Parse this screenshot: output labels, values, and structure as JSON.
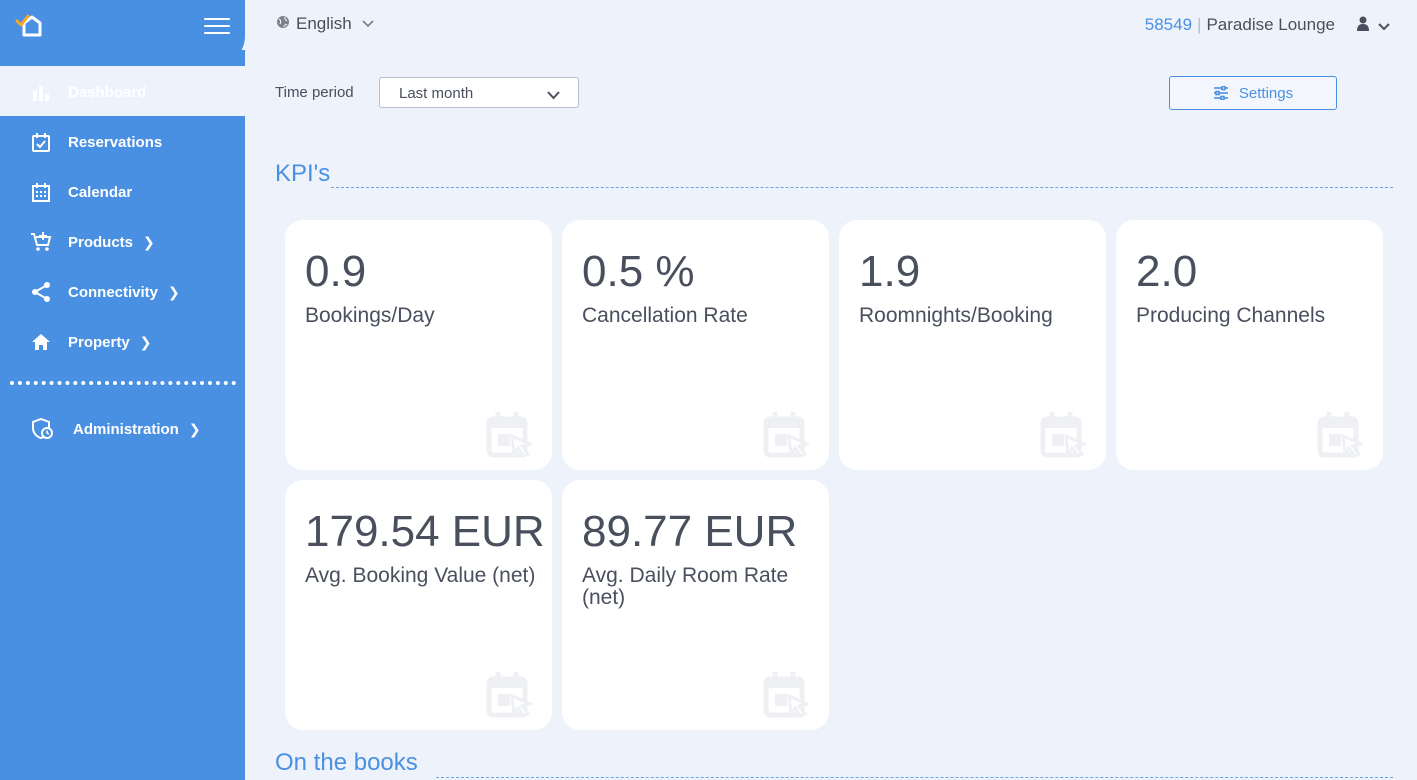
{
  "sidebar": {
    "items": [
      {
        "label": "Dashboard",
        "icon": "bar-chart-icon",
        "active": true
      },
      {
        "label": "Reservations",
        "icon": "calendar-check-icon"
      },
      {
        "label": "Calendar",
        "icon": "calendar-grid-icon"
      },
      {
        "label": "Products",
        "icon": "cart-plus-icon",
        "has_children": true
      },
      {
        "label": "Connectivity",
        "icon": "share-icon",
        "has_children": true
      },
      {
        "label": "Property",
        "icon": "home-icon",
        "has_children": true
      },
      {
        "label": "Administration",
        "icon": "shield-clock-icon",
        "has_children": true
      }
    ]
  },
  "header": {
    "language": "English",
    "account_id": "58549",
    "property_name": "Paradise Lounge"
  },
  "filters": {
    "time_period_label": "Time period",
    "time_period_value": "Last month",
    "settings_label": "Settings"
  },
  "sections": {
    "kpis": "KPI's",
    "on_the_books": "On the books"
  },
  "kpis": [
    {
      "value": "0.9",
      "label": "Bookings/Day"
    },
    {
      "value": "0.5 %",
      "label": "Cancellation Rate"
    },
    {
      "value": "1.9",
      "label": "Roomnights/Booking"
    },
    {
      "value": "2.0",
      "label": "Producing Channels"
    },
    {
      "value": "179.54 EUR",
      "label": "Avg. Booking Value (net)"
    },
    {
      "value": "89.77 EUR",
      "label": "Avg. Daily Room Rate (net)"
    }
  ],
  "colors": {
    "brand_blue": "#4a90e2",
    "background": "#eef3fb",
    "card": "#ffffff",
    "text": "#4a4f5e",
    "logo_accent": "#f5a623"
  }
}
